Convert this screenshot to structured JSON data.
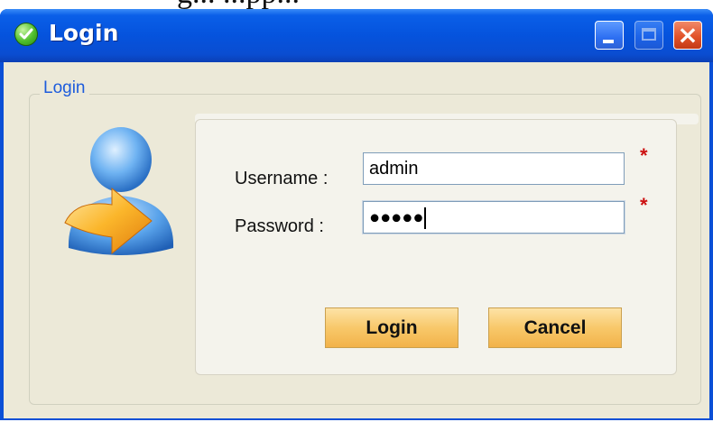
{
  "caption": "g... ...pp...",
  "window": {
    "title": "Login",
    "minimize_label": "Minimize",
    "maximize_label": "Maximize",
    "close_glyph": "×"
  },
  "group": {
    "title": "Login"
  },
  "form": {
    "username_label": "Username :",
    "username_value": "admin",
    "password_label": "Password :",
    "password_mask": "●●●●●",
    "required_marker": "*"
  },
  "buttons": {
    "login": "Login",
    "cancel": "Cancel"
  },
  "icons": {
    "app": "check-icon",
    "avatar": "user-login-icon"
  },
  "colors": {
    "titlebar": "#0553dd",
    "group_title": "#1d5cdc",
    "button_fill": "#f8c86a",
    "required": "#cc1111"
  }
}
